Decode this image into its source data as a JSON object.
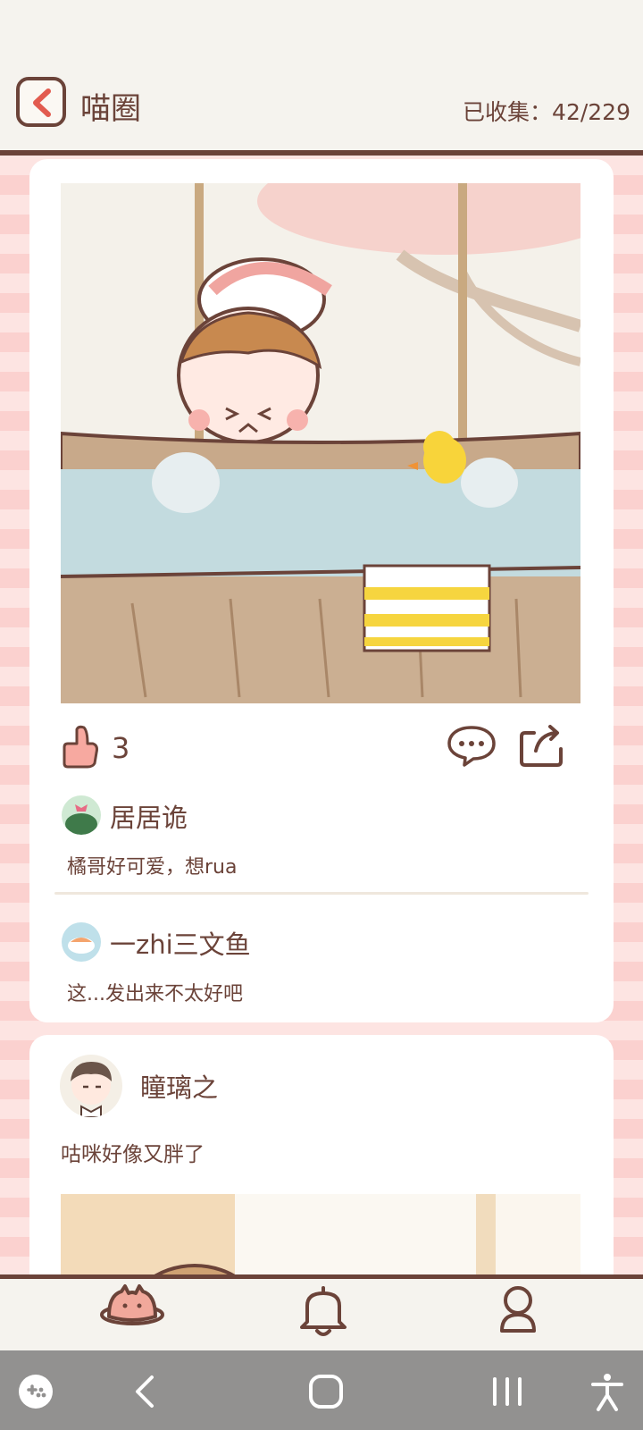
{
  "header": {
    "title": "喵圈",
    "collected_label": "已收集：42/229"
  },
  "post1": {
    "likes": "3",
    "comments": [
      {
        "name": "居居诡",
        "text": "橘哥好可爱，想rua"
      },
      {
        "name": "一zhi三文鱼",
        "text": "这...发出来不太好吧"
      }
    ]
  },
  "post2": {
    "author": "瞳璃之",
    "text": "咕咪好像又胖了"
  },
  "tabs": [
    "planet-icon",
    "bell-icon",
    "profile-icon"
  ],
  "colors": {
    "accent_brown": "#6b4339",
    "background": "#f5f3ee",
    "pink_stripe": "#fbd1cf",
    "card": "#ffffff"
  }
}
